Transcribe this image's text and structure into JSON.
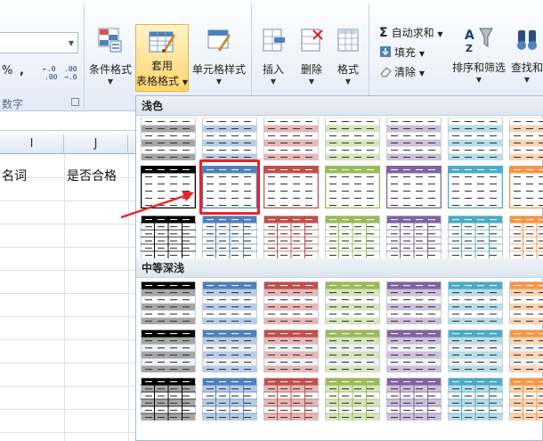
{
  "ribbon": {
    "number_group": {
      "percent_label": "%",
      "comma_label": ",",
      "increase_decimal_label": "←.0\n.00",
      "decrease_decimal_label": ".00\n→.0",
      "group_label": "数字"
    },
    "styles_group": {
      "conditional_format": "条件格式",
      "table_format_line1": "套用",
      "table_format_line2": "表格格式",
      "cell_styles": "单元格样式"
    },
    "cells_group": {
      "insert": "插入",
      "delete": "删除",
      "format": "格式"
    },
    "editing_group": {
      "autosum": "自动求和",
      "fill": "填充",
      "clear": "清除",
      "sort_filter": "排序和筛选",
      "find_select": "查找和"
    }
  },
  "sheet": {
    "columns": [
      "I",
      "J"
    ],
    "cells": [
      "名词",
      "是否合格"
    ]
  },
  "gallery": {
    "sections": [
      {
        "title": "浅色"
      },
      {
        "title": "中等深浅"
      }
    ],
    "palette": [
      "#000000",
      "#4f81bd",
      "#c0504d",
      "#9bbb59",
      "#8064a2",
      "#4bacc6",
      "#f79646"
    ],
    "light_palette": [
      "#a6a6a6",
      "#b8cce4",
      "#e6b8b7",
      "#d7e4bc",
      "#ccc0da",
      "#b7dde8",
      "#fbd4b4"
    ],
    "selected_style_index": 1
  }
}
